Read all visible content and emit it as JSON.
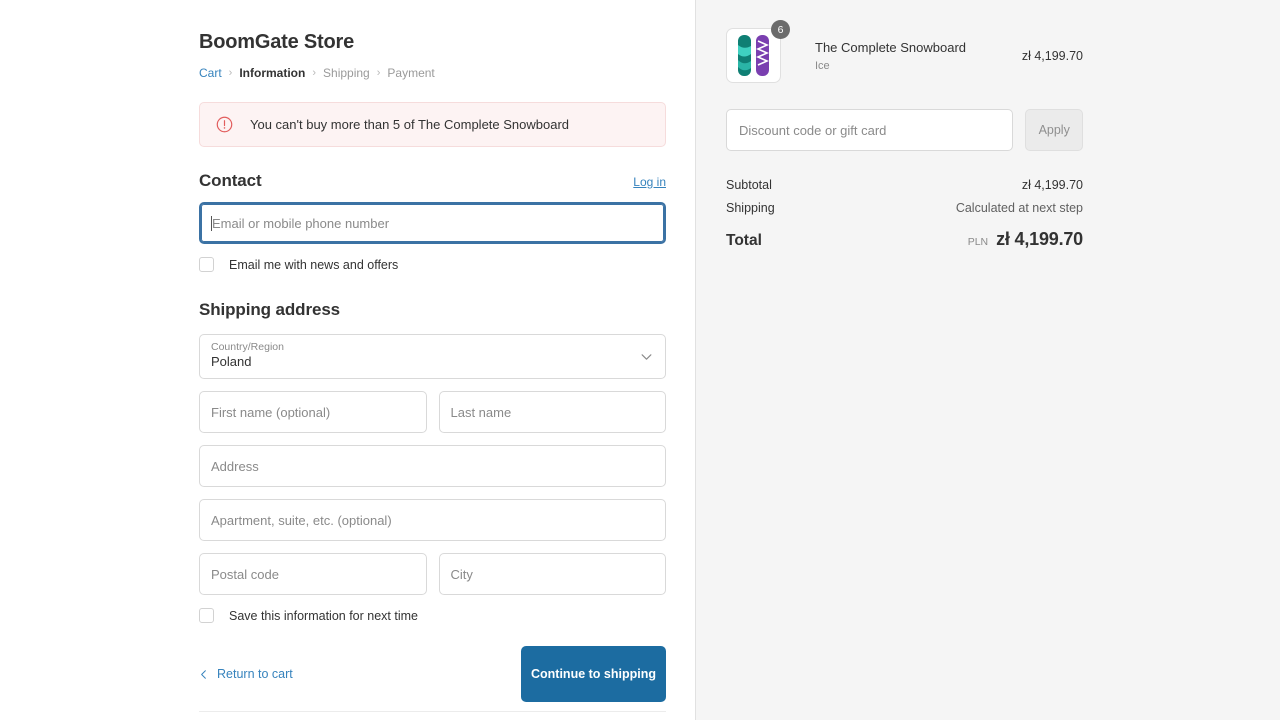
{
  "store": {
    "name": "BoomGate Store"
  },
  "breadcrumb": {
    "cart": "Cart",
    "information": "Information",
    "shipping": "Shipping",
    "payment": "Payment",
    "separator": "›"
  },
  "alert": {
    "message": "You can't buy more than 5 of The Complete Snowboard",
    "icon": "error-circle-icon",
    "bg_color": "#fdf3f3",
    "border_color": "#f6dcdc",
    "icon_color": "#e25c5c"
  },
  "contact": {
    "title": "Contact",
    "login_label": "Log in",
    "email_placeholder": "Email or mobile phone number",
    "email_value": "",
    "newsletter_label": "Email me with news and offers",
    "newsletter_checked": false
  },
  "shipping_address": {
    "title": "Shipping address",
    "country_label": "Country/Region",
    "country_value": "Poland",
    "first_name_placeholder": "First name (optional)",
    "last_name_placeholder": "Last name",
    "address_placeholder": "Address",
    "apartment_placeholder": "Apartment, suite, etc. (optional)",
    "postal_code_placeholder": "Postal code",
    "city_placeholder": "City",
    "save_info_label": "Save this information for next time",
    "save_info_checked": false
  },
  "actions": {
    "return_label": "Return to cart",
    "continue_label": "Continue to shipping",
    "cta_color": "#1c6ca1"
  },
  "summary": {
    "item": {
      "title": "The Complete Snowboard",
      "variant": "Ice",
      "quantity": "6",
      "price": "zł 4,199.70"
    },
    "discount_placeholder": "Discount code or gift card",
    "discount_value": "",
    "apply_label": "Apply",
    "subtotal_label": "Subtotal",
    "subtotal_value": "zł 4,199.70",
    "shipping_label": "Shipping",
    "shipping_value": "Calculated at next step",
    "total_label": "Total",
    "total_currency": "PLN",
    "total_value": "zł 4,199.70",
    "panel_color": "#f5f5f5"
  }
}
